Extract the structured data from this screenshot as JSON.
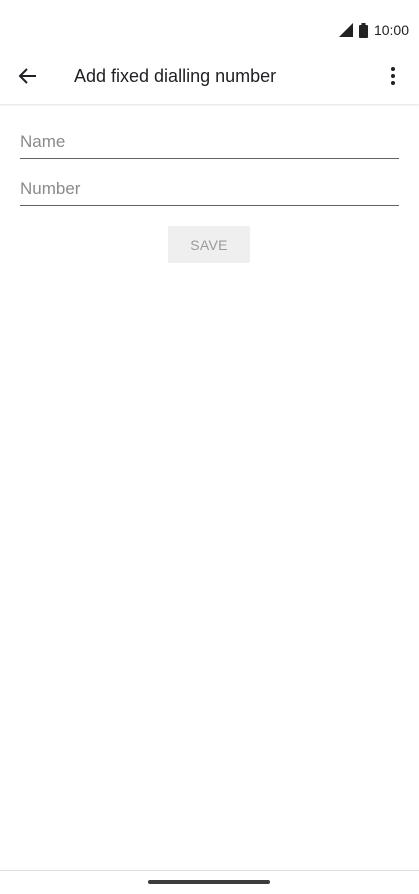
{
  "status_bar": {
    "time": "10:00",
    "icons": [
      "signal-icon",
      "battery-icon"
    ]
  },
  "app_bar": {
    "title": "Add fixed dialling number",
    "back_icon": "arrow-left-icon",
    "menu_icon": "more-vert-icon"
  },
  "form": {
    "name": {
      "placeholder": "Name",
      "value": ""
    },
    "number": {
      "placeholder": "Number",
      "value": ""
    },
    "save_label": "SAVE"
  },
  "colors": {
    "button_bg": "#efefef",
    "button_text": "#9a9a9a",
    "underline": "#5f6368",
    "placeholder": "#8a8a8a"
  }
}
